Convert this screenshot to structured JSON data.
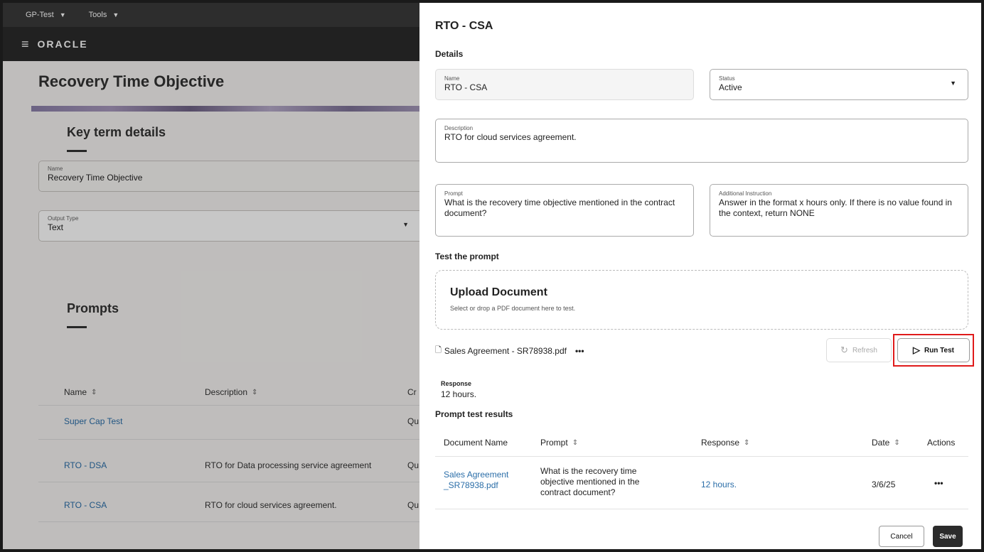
{
  "topbar": {
    "menu1": "GP-Test",
    "menu2": "Tools"
  },
  "brand": "ORACLE",
  "background": {
    "page_title": "Recovery Time Objective",
    "key_term_title": "Key term details",
    "name_label": "Name",
    "name_value": "Recovery Time Objective",
    "output_label": "Output Type",
    "output_value": "Text",
    "prompts_title": "Prompts",
    "columns": [
      "Name",
      "Description",
      "Cr"
    ],
    "rows": [
      {
        "name": "Super Cap Test",
        "description": "",
        "extra": "Qu"
      },
      {
        "name": "RTO - DSA",
        "description": "RTO for Data processing service agreement",
        "extra": "Qu"
      },
      {
        "name": "RTO - CSA",
        "description": "RTO for cloud services agreement.",
        "extra": "Qu"
      }
    ]
  },
  "drawer": {
    "title": "RTO - CSA",
    "details_heading": "Details",
    "name": {
      "label": "Name",
      "value": "RTO - CSA"
    },
    "status": {
      "label": "Status",
      "value": "Active"
    },
    "description": {
      "label": "Description",
      "value": "RTO for cloud services agreement."
    },
    "prompt": {
      "label": "Prompt",
      "value": "What is the recovery time objective mentioned in the contract document?"
    },
    "instruction": {
      "label": "Additional Instruction",
      "value": "Answer in the format x hours only. If there is no value found in the context, return NONE"
    },
    "test_heading": "Test the prompt",
    "upload": {
      "title": "Upload Document",
      "subtitle": "Select or drop a PDF document here to test."
    },
    "file_name": "Sales Agreement - SR78938.pdf",
    "refresh_label": "Refresh",
    "run_label": "Run Test",
    "response_label": "Response",
    "response_value": "12 hours.",
    "results_heading": "Prompt test results",
    "results_columns": [
      "Document Name",
      "Prompt",
      "Response",
      "Date",
      "Actions"
    ],
    "results_row": {
      "document": "Sales Agreement _SR78938.pdf",
      "prompt": "What is the recovery time objective mentioned in the contract document?",
      "response": "12 hours.",
      "date": "3/6/25"
    },
    "cancel_label": "Cancel",
    "save_label": "Save"
  }
}
